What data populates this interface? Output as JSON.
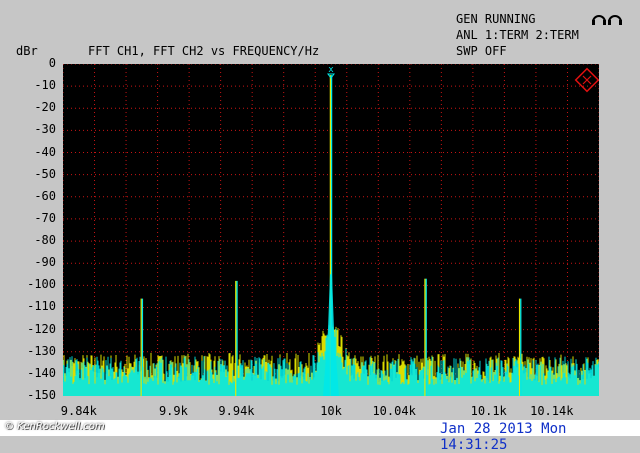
{
  "header": {
    "status_line1": "GEN RUNNING",
    "status_line2": "ANL 1:TERM 2:TERM",
    "status_line3": "SWP OFF",
    "y_unit": "dBr",
    "trace_title": "FFT   CH1,    FFT   CH2 vs    FREQUENCY/Hz"
  },
  "footer": {
    "watermark": "© KenRockwell.com",
    "datetime": "Jan 28 2013 Mon 14:31:25"
  },
  "colors": {
    "background": "#c6c6c6",
    "plot_bg": "#000000",
    "grid": "#c81414",
    "ch1": "#e8e800",
    "ch2": "#00e8e8",
    "logo": "#e01010",
    "datetime": "#1030c8"
  },
  "chart_data": {
    "type": "line",
    "title": "FFT CH1, FFT CH2 vs FREQUENCY/Hz",
    "xlabel": "FREQUENCY/Hz",
    "ylabel": "dBr",
    "xlim": [
      9830,
      10170
    ],
    "ylim": [
      -150,
      0
    ],
    "x_tick_labels": [
      {
        "value": 9840,
        "label": "9.84k"
      },
      {
        "value": 9900,
        "label": "9.9k"
      },
      {
        "value": 9940,
        "label": "9.94k"
      },
      {
        "value": 10000,
        "label": "10k"
      },
      {
        "value": 10040,
        "label": "10.04k"
      },
      {
        "value": 10100,
        "label": "10.1k"
      },
      {
        "value": 10140,
        "label": "10.14k"
      }
    ],
    "y_ticks": [
      0,
      -10,
      -20,
      -30,
      -40,
      -50,
      -60,
      -70,
      -80,
      -90,
      -100,
      -110,
      -120,
      -130,
      -140,
      -150
    ],
    "grid": true,
    "noise_floor": [
      -145,
      -132
    ],
    "series": [
      {
        "name": "CH1",
        "color": "#e8e800",
        "peaks": [
          {
            "x": 10000,
            "y": -5
          },
          {
            "x": 9940,
            "y": -98
          },
          {
            "x": 10060,
            "y": -97
          },
          {
            "x": 9880,
            "y": -106
          },
          {
            "x": 10120,
            "y": -106
          }
        ]
      },
      {
        "name": "CH2",
        "color": "#00e8e8",
        "peaks": [
          {
            "x": 10000,
            "y": -5
          },
          {
            "x": 9940,
            "y": -98
          },
          {
            "x": 10060,
            "y": -97
          },
          {
            "x": 9880,
            "y": -106
          },
          {
            "x": 10120,
            "y": -106
          }
        ]
      }
    ],
    "markers": [
      {
        "x": 10000,
        "y": 0,
        "label": "x"
      }
    ]
  }
}
